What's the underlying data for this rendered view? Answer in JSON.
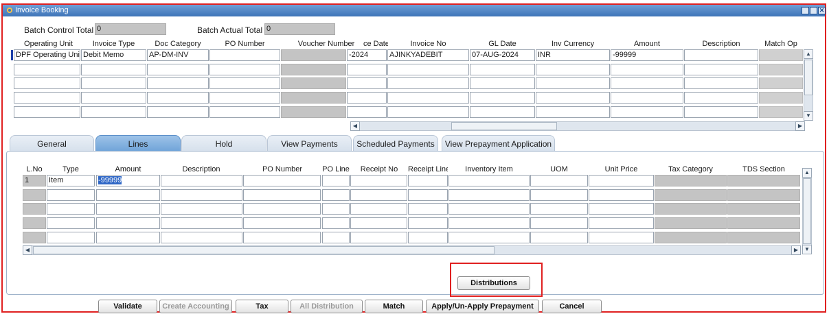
{
  "window": {
    "title": "Invoice Booking",
    "buttons": [
      "minimize",
      "restore",
      "close"
    ]
  },
  "header": {
    "batch_control_total_label": "Batch Control Total",
    "batch_control_total_value": "0",
    "batch_actual_total_label": "Batch Actual Total",
    "batch_actual_total_value": "0"
  },
  "invoices": {
    "columns": [
      "Operating Unit",
      "Invoice Type",
      "Doc Category",
      "PO Number",
      "Voucher Number",
      "ce Date",
      "Invoice No",
      "GL Date",
      "Inv Currency",
      "Amount",
      "Description",
      "Match Op"
    ],
    "rows": [
      [
        "DPF Operating Uni",
        "Debit Memo",
        "AP-DM-INV",
        "",
        "",
        "-2024",
        "AJINKYADEBIT",
        "07-AUG-2024",
        "INR",
        "-99999",
        "",
        ""
      ],
      [
        "",
        "",
        "",
        "",
        "",
        "",
        "",
        "",
        "",
        "",
        "",
        ""
      ],
      [
        "",
        "",
        "",
        "",
        "",
        "",
        "",
        "",
        "",
        "",
        "",
        ""
      ],
      [
        "",
        "",
        "",
        "",
        "",
        "",
        "",
        "",
        "",
        "",
        "",
        ""
      ],
      [
        "",
        "",
        "",
        "",
        "",
        "",
        "",
        "",
        "",
        "",
        "",
        ""
      ]
    ]
  },
  "tabs": [
    "General",
    "Lines",
    "Hold",
    "View Payments",
    "Scheduled Payments",
    "View Prepayment Application"
  ],
  "active_tab": "Lines",
  "lines": {
    "columns": [
      "L.No",
      "Type",
      "Amount",
      "Description",
      "PO Number",
      "PO Line",
      "Receipt No",
      "Receipt Line",
      "Inventory Item",
      "UOM",
      "Unit Price",
      "Tax Category",
      "TDS Section"
    ],
    "rows": [
      [
        "1",
        "Item",
        "-99999",
        "",
        "",
        "",
        "",
        "",
        "",
        "",
        "",
        "",
        ""
      ],
      [
        "",
        "",
        "",
        "",
        "",
        "",
        "",
        "",
        "",
        "",
        "",
        "",
        ""
      ],
      [
        "",
        "",
        "",
        "",
        "",
        "",
        "",
        "",
        "",
        "",
        "",
        "",
        ""
      ],
      [
        "",
        "",
        "",
        "",
        "",
        "",
        "",
        "",
        "",
        "",
        "",
        "",
        ""
      ],
      [
        "",
        "",
        "",
        "",
        "",
        "",
        "",
        "",
        "",
        "",
        "",
        "",
        ""
      ]
    ]
  },
  "distributions_button": "Distributions",
  "actions": [
    {
      "label": "Validate",
      "enabled": true
    },
    {
      "label": "Create Accounting",
      "enabled": false
    },
    {
      "label": "Tax",
      "enabled": true
    },
    {
      "label": "All Distribution",
      "enabled": false
    },
    {
      "label": "Match",
      "enabled": true
    },
    {
      "label": "Apply/Un-Apply Prepayment",
      "enabled": true
    },
    {
      "label": "Cancel",
      "enabled": true
    }
  ],
  "colors": {
    "title_bar": "#3e74b8",
    "active_tab": "#6fa3d8",
    "highlight_frame": "#e02020",
    "selection": "#2f67c6"
  }
}
